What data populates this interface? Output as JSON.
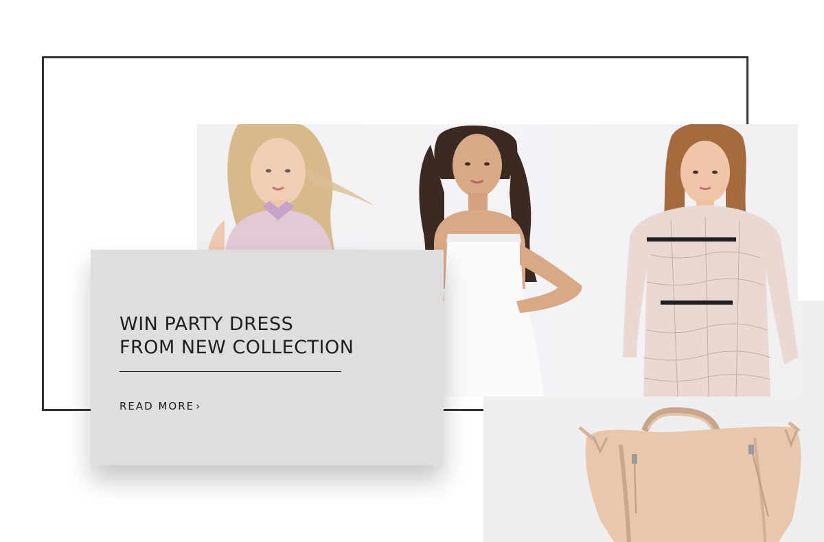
{
  "promo": {
    "title_line1": "WIN PARTY DRESS",
    "title_line2": "FROM NEW COLLECTION",
    "read_more_label": "READ MORE",
    "read_more_icon": "chevron-right-icon"
  },
  "colors": {
    "frame_border": "#333333",
    "card_background": "#dedede",
    "page_background": "#ffffff",
    "bag_panel_background": "#efefef",
    "text": "#1f1f1f"
  },
  "images": {
    "hero": "three-models-in-party-dresses",
    "product": "beige-leather-handbag"
  }
}
